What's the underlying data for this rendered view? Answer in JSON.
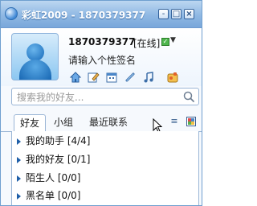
{
  "window": {
    "title": "彩虹2009 - 1870379377",
    "minimize_label": "-",
    "restore_label": "□",
    "close_label": "×"
  },
  "profile": {
    "username": "1870379377",
    "status": "[在线]",
    "signature": "请输入个性签名",
    "toolbar_icons": [
      "home-icon",
      "edit-icon",
      "calendar-icon",
      "link-icon",
      "music-icon",
      "app-icon"
    ]
  },
  "search": {
    "placeholder": "搜索我的好友..."
  },
  "tabs": {
    "items": [
      "好友",
      "小组",
      "最近联系"
    ],
    "active": "好友"
  },
  "groups": [
    {
      "label": "我的助手 [4/4]"
    },
    {
      "label": "我的好友 [0/1]"
    },
    {
      "label": "陌生人 [0/0]"
    },
    {
      "label": "黑名单 [0/0]"
    }
  ],
  "colors": {
    "titlebar": "#8fb8e3",
    "border": "#9bb6d6",
    "status_online": "#4fb64d"
  }
}
